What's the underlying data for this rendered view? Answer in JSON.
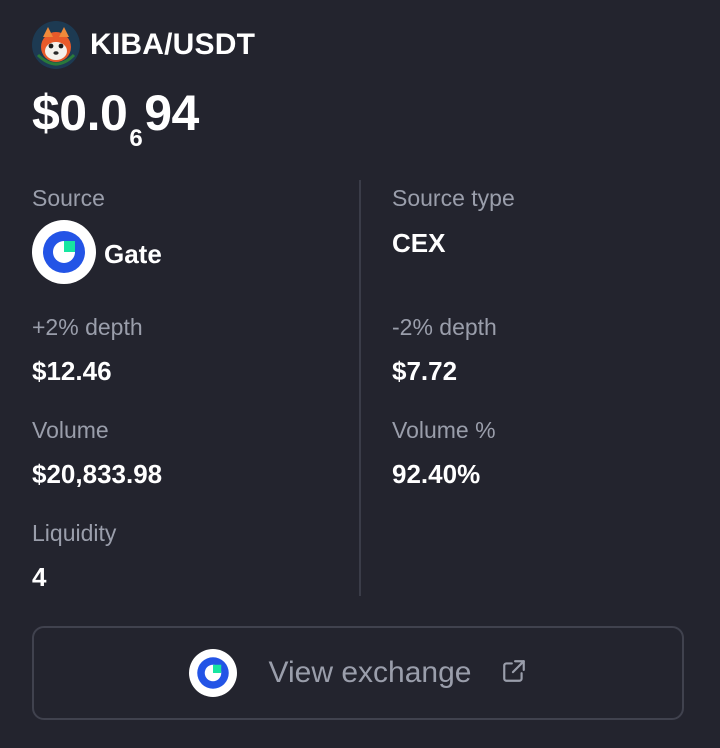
{
  "header": {
    "pair": "KIBA/USDT",
    "token_icon": "kiba-token-icon"
  },
  "price": {
    "prefix": "$0.0",
    "zero_count": "6",
    "digits": "94"
  },
  "details": {
    "source_label": "Source",
    "source_name": "Gate",
    "source_icon": "gate-logo-icon",
    "source_type_label": "Source type",
    "source_type_value": "CEX",
    "plus_depth_label": "+2% depth",
    "plus_depth_value": "$12.46",
    "minus_depth_label": "-2% depth",
    "minus_depth_value": "$7.72",
    "volume_label": "Volume",
    "volume_value": "$20,833.98",
    "volume_pct_label": "Volume %",
    "volume_pct_value": "92.40%",
    "liquidity_label": "Liquidity",
    "liquidity_value": "4"
  },
  "action": {
    "label": "View exchange",
    "icon": "external-link-icon"
  },
  "colors": {
    "background": "#23242e",
    "label": "#9a9eab",
    "value": "#ffffff",
    "gate_blue": "#2354e6",
    "gate_green": "#17e6a1",
    "border": "#40424e"
  }
}
